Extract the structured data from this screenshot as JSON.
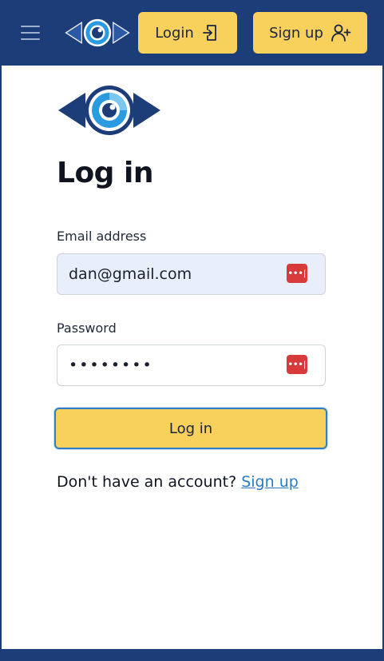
{
  "header": {
    "login_label": "Login",
    "signup_label": "Sign up",
    "brand_color": "#1c3d78",
    "accent_color": "#f7d15c"
  },
  "form": {
    "title": "Log in",
    "email_label": "Email address",
    "email_value": "dan@gmail.com",
    "password_label": "Password",
    "password_value": "••••••••",
    "submit_label": "Log in",
    "password_manager_icon": "•••|"
  },
  "footer": {
    "prompt": "Don't have an account? ",
    "signup_link": "Sign up"
  }
}
